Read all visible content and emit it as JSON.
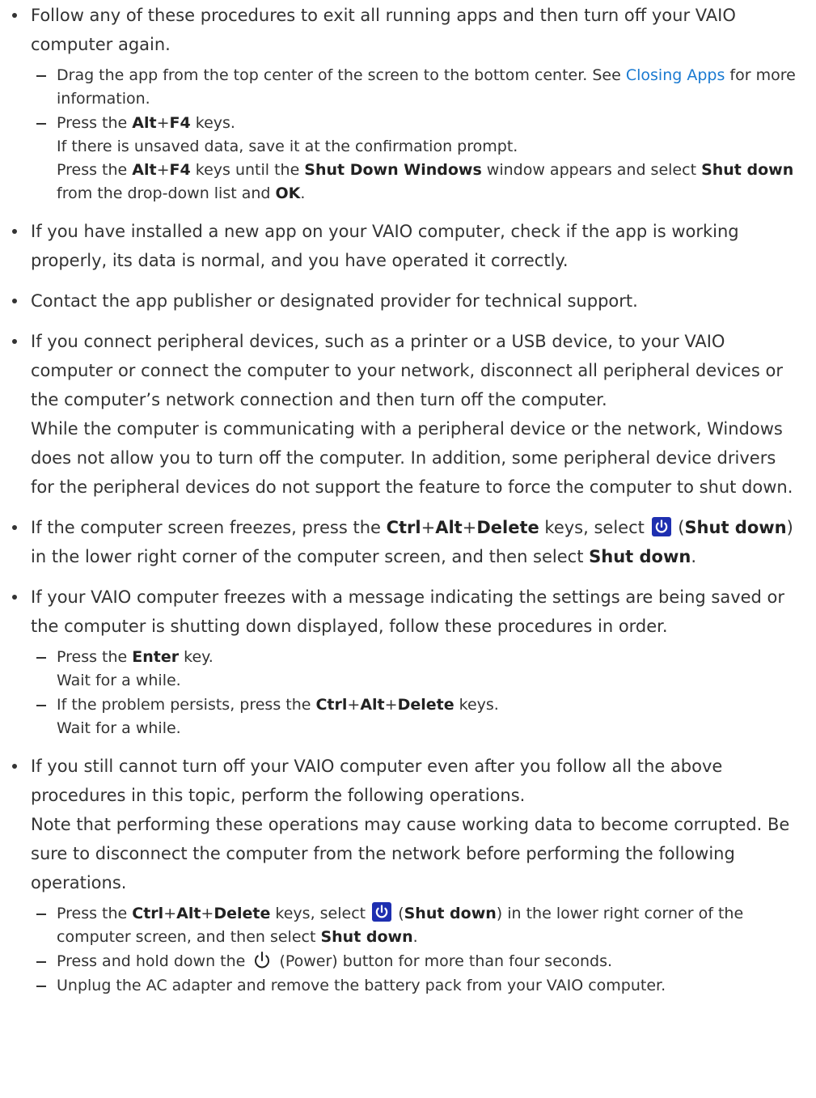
{
  "items": [
    {
      "text": "Follow any of these procedures to exit all running apps and then turn off your VAIO computer again.",
      "sub": [
        {
          "p1": "Drag the app from the top center of the screen to the bottom center. See ",
          "link": "Closing Apps",
          "p2": " for more information."
        },
        {
          "l1_a": "Press the ",
          "l1_k1": "Alt",
          "l1_plus": "+",
          "l1_k2": "F4",
          "l1_b": " keys.",
          "l2": "If there is unsaved data, save it at the confirmation prompt.",
          "l3_a": "Press the ",
          "l3_k1": "Alt",
          "l3_plus": "+",
          "l3_k2": "F4",
          "l3_b": " keys until the ",
          "l3_k3": "Shut Down Windows",
          "l3_c": " window appears and select ",
          "l3_k4": "Shut down",
          "l3_d": " from the drop-down list and ",
          "l3_k5": "OK",
          "l3_e": "."
        }
      ]
    },
    {
      "text": "If you have installed a new app on your VAIO computer, check if the app is working properly, its data is normal, and you have operated it correctly."
    },
    {
      "text": "Contact the app publisher or designated provider for technical support."
    },
    {
      "text": "If you connect peripheral devices, such as a printer or a USB device, to your VAIO computer or connect the computer to your network, disconnect all peripheral devices or the computer’s network connection and then turn off the computer.",
      "text2": "While the computer is communicating with a peripheral device or the network, Windows does not allow you to turn off the computer. In addition, some peripheral device drivers for the peripheral devices do not support the feature to force the computer to shut down."
    },
    {
      "a": "If the computer screen freezes, press the ",
      "k1": "Ctrl",
      "plus1": "+",
      "k2": "Alt",
      "plus2": "+",
      "k3": "Delete",
      "b": " keys, select ",
      "c": " (",
      "k4": "Shut down",
      "d": ") in the lower right corner of the computer screen, and then select ",
      "k5": "Shut down",
      "e": "."
    },
    {
      "text": "If your VAIO computer freezes with a message indicating the settings are being saved or the computer is shutting down displayed, follow these procedures in order.",
      "sub": [
        {
          "a": "Press the ",
          "k1": "Enter",
          "b": " key.",
          "l2": "Wait for a while."
        },
        {
          "a": "If the problem persists, press the ",
          "k1": "Ctrl",
          "plus1": "+",
          "k2": "Alt",
          "plus2": "+",
          "k3": "Delete",
          "b": " keys.",
          "l2": "Wait for a while."
        }
      ]
    },
    {
      "text": "If you still cannot turn off your VAIO computer even after you follow all the above procedures in this topic, perform the following operations.",
      "text2": "Note that performing these operations may cause working data to become corrupted. Be sure to disconnect the computer from the network before performing the following operations.",
      "sub": [
        {
          "a": "Press the ",
          "k1": "Ctrl",
          "plus1": "+",
          "k2": "Alt",
          "plus2": "+",
          "k3": "Delete",
          "b": " keys, select ",
          "c": " (",
          "k4": "Shut down",
          "d": ") in the lower right corner of the computer screen, and then select ",
          "k5": "Shut down",
          "e": "."
        },
        {
          "a": "Press and hold down the ",
          "b": " (Power) button for more than four seconds."
        },
        {
          "a": "Unplug the AC adapter and remove the battery pack from your VAIO computer."
        }
      ]
    }
  ],
  "icons": {
    "shutdown": "shut-down-icon",
    "power": "power-icon",
    "shutdown_bg": "#1e2fb0",
    "link_color": "#1a7ad1"
  }
}
